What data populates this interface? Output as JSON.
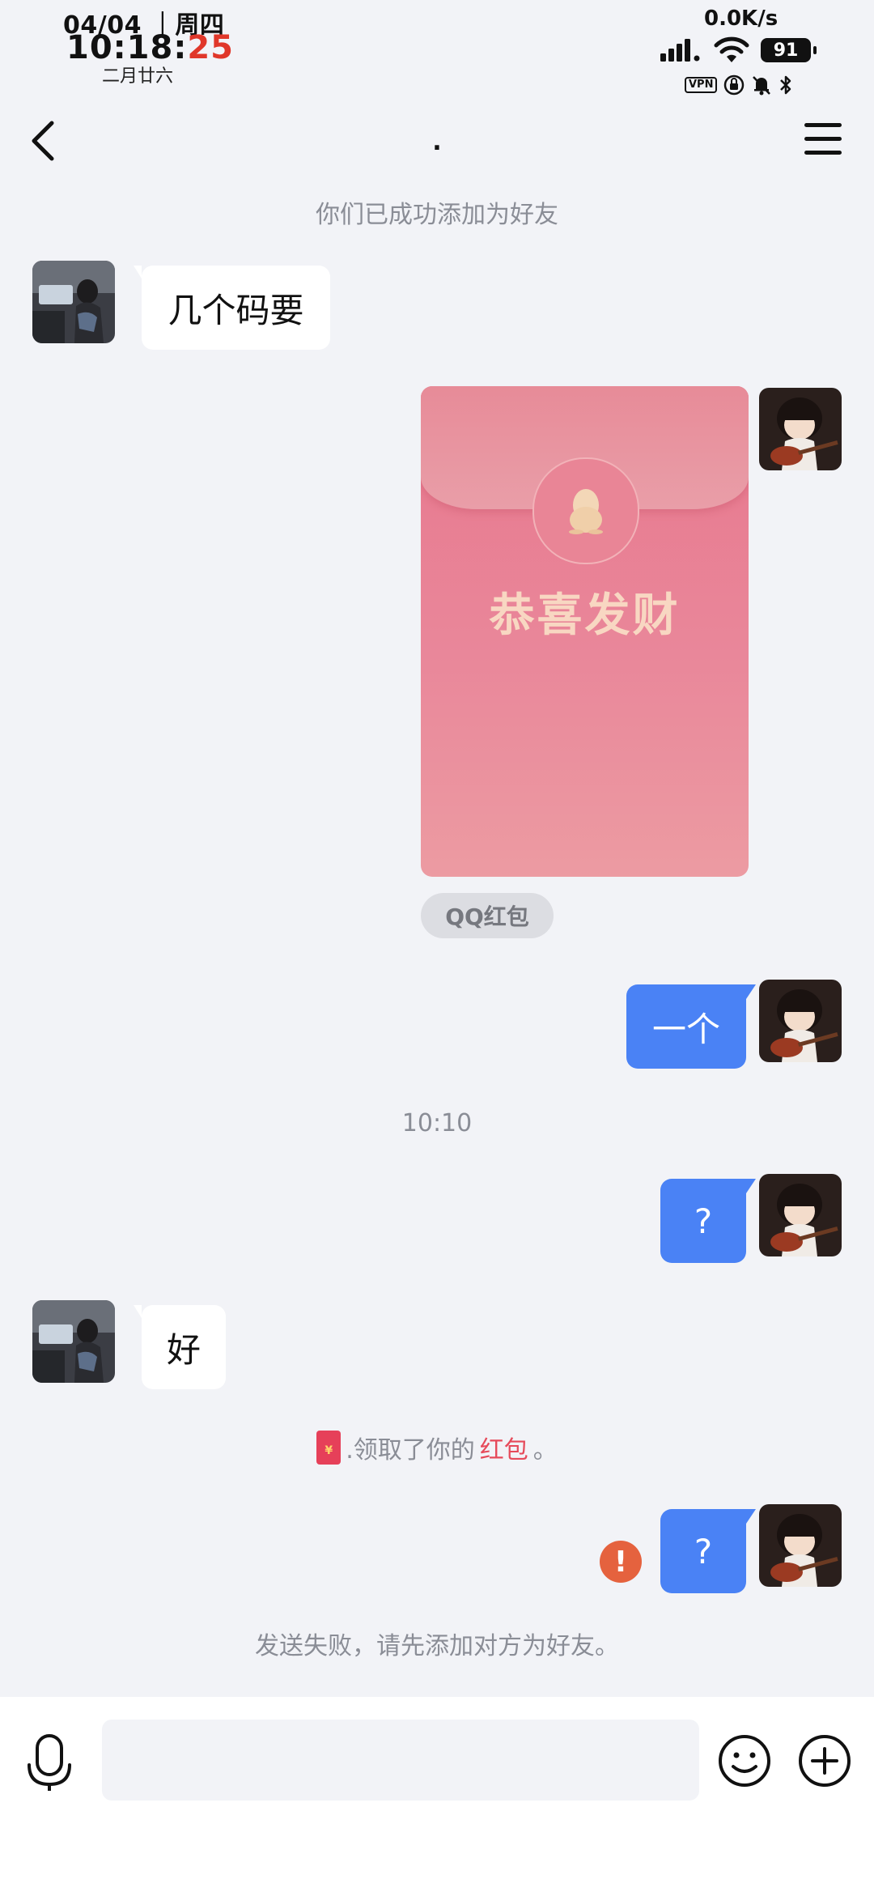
{
  "status_bar": {
    "date": "04/04 ｜周四",
    "time_hm": "10:18:",
    "time_s": "25",
    "lunar": "二月廿六",
    "net_speed": "0.0K/s",
    "battery": "91",
    "vpn": "VPN"
  },
  "nav": {
    "title": "."
  },
  "system": {
    "added_friend": "你们已成功添加为好友",
    "send_failed": "发送失败，请先添加对方为好友。"
  },
  "messages": [
    {
      "side": "in",
      "text": "几个码要"
    },
    {
      "side": "out",
      "type": "red_packet",
      "packet_title": "恭喜发财",
      "packet_tag": "QQ红包"
    },
    {
      "side": "out",
      "text": "一个"
    },
    {
      "side": "out",
      "text": "?"
    },
    {
      "side": "in",
      "text": "好"
    },
    {
      "side": "out",
      "text": "?",
      "failed": true
    }
  ],
  "time_label": "10:10",
  "notice": {
    "prefix": ".领取了你的",
    "highlight": "红包",
    "suffix": "。",
    "icon_glyph": "¥"
  },
  "input": {
    "placeholder": ""
  },
  "colors": {
    "bubble_out": "#4a82f5",
    "background": "#f2f3f7",
    "red_packet": "#e8778d",
    "error": "#e5623e"
  }
}
